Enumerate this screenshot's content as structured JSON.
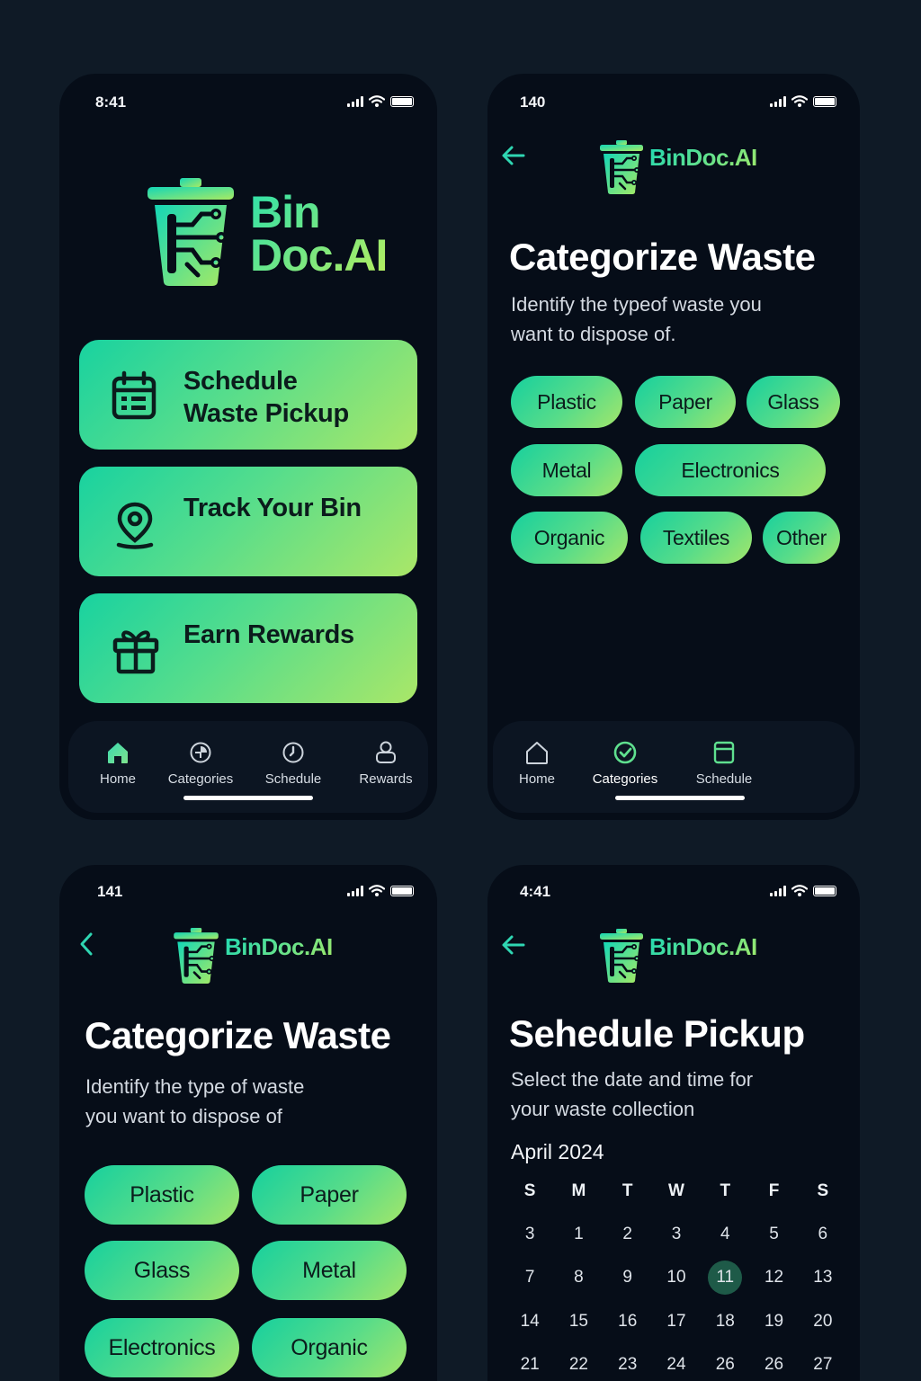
{
  "screen1": {
    "time": "8:41",
    "brand_line1": "Bin",
    "brand_line2": "Doc.AI",
    "cards": [
      {
        "line1": "Schedule",
        "line2": "Waste Pickup",
        "icon": "calendar-icon"
      },
      {
        "line1": "Track Your Bin",
        "line2": "",
        "icon": "location-pin-icon"
      },
      {
        "line1": "Earn Rewards",
        "line2": "",
        "icon": "gift-icon"
      }
    ],
    "nav": [
      {
        "label": "Home",
        "icon": "home-icon",
        "active": true
      },
      {
        "label": "Categories",
        "icon": "categories-icon"
      },
      {
        "label": "Schedule",
        "icon": "clock-icon"
      },
      {
        "label": "Rewards",
        "icon": "rewards-icon"
      }
    ]
  },
  "screen2": {
    "time": "140",
    "brand": "BinDoc.AI",
    "title": "Categorize Waste",
    "subtitle_line1": "Identify the typeof waste you",
    "subtitle_line2": "want to dispose of.",
    "categories": [
      "Plastic",
      "Paper",
      "Glass",
      "Metal",
      "Electronics",
      "Organic",
      "Textiles",
      "Other"
    ],
    "nav": [
      {
        "label": "Home",
        "icon": "home-icon"
      },
      {
        "label": "Categories",
        "icon": "check-circle-icon",
        "active": true
      },
      {
        "label": "Schedule",
        "icon": "calendar-icon"
      }
    ]
  },
  "screen3": {
    "time": "141",
    "brand": "BinDoc.AI",
    "title": "Categorize Waste",
    "subtitle_line1": "Identify the type of waste",
    "subtitle_line2": "you want to dispose of",
    "categories": [
      "Plastic",
      "Paper",
      "Glass",
      "Metal",
      "Electronics",
      "Organic"
    ]
  },
  "screen4": {
    "time": "4:41",
    "brand": "BinDoc.AI",
    "title": "Sehedule Pickup",
    "subtitle_line1": "Select the date and time for",
    "subtitle_line2": "your waste collection",
    "month": "April 2024",
    "weekdays": [
      "S",
      "M",
      "T",
      "W",
      "T",
      "F",
      "S"
    ],
    "weeks": [
      [
        "3",
        "1",
        "2",
        "3",
        "4",
        "5",
        "6"
      ],
      [
        "7",
        "8",
        "9",
        "10",
        "11",
        "12",
        "13"
      ],
      [
        "14",
        "15",
        "16",
        "17",
        "18",
        "19",
        "20"
      ],
      [
        "21",
        "22",
        "23",
        "24",
        "26",
        "26",
        "27"
      ]
    ],
    "selected_day": "11"
  },
  "colors": {
    "accent_start": "#16d09e",
    "accent_end": "#a4e66a",
    "background": "#0f1a26",
    "phone": "#060d18"
  }
}
